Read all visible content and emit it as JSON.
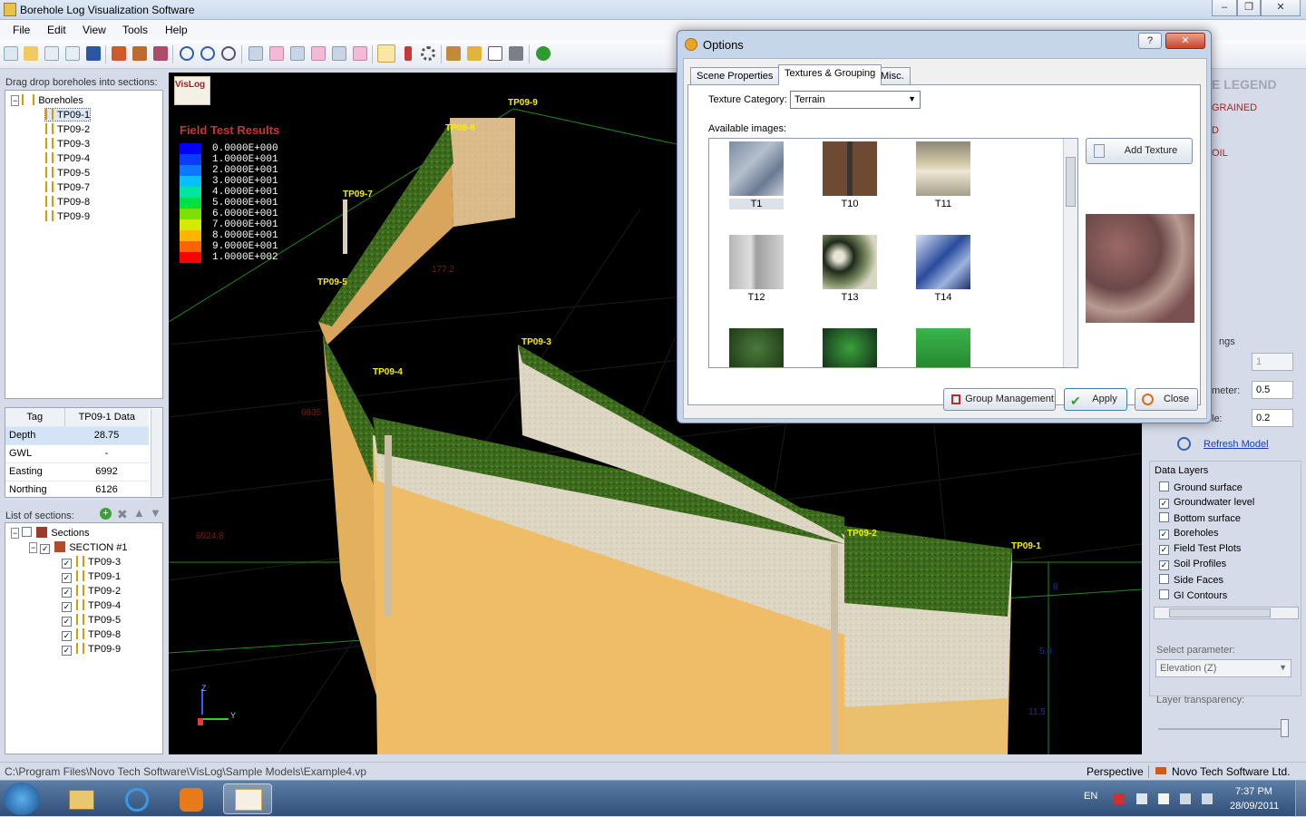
{
  "window": {
    "title": "Borehole Log Visualization Software"
  },
  "menu": [
    "File",
    "Edit",
    "View",
    "Tools",
    "Help"
  ],
  "left": {
    "hint": "Drag  drop boreholes into sections:",
    "tree_root": "Boreholes",
    "boreholes": [
      "TP09-1",
      "TP09-2",
      "TP09-3",
      "TP09-4",
      "TP09-5",
      "TP09-7",
      "TP09-8",
      "TP09-9"
    ],
    "grid_headers": [
      "Tag",
      "TP09-1 Data"
    ],
    "grid_rows": [
      {
        "tag": "Depth",
        "value": "28.75"
      },
      {
        "tag": "GWL",
        "value": "-"
      },
      {
        "tag": "Easting",
        "value": "6992"
      },
      {
        "tag": "Northing",
        "value": "6126"
      }
    ],
    "sections_label": "List of sections:",
    "sections_root": "Sections",
    "section_name": "SECTION #1",
    "section_items": [
      "TP09-3",
      "TP09-1",
      "TP09-2",
      "TP09-4",
      "TP09-5",
      "TP09-8",
      "TP09-9"
    ]
  },
  "viewport": {
    "logo_text": "VisLog",
    "legend_title": "Field Test Results",
    "legend": [
      {
        "label": "0.0000E+000",
        "color": "#0000ff"
      },
      {
        "label": "1.0000E+001",
        "color": "#0a3cff"
      },
      {
        "label": "2.0000E+001",
        "color": "#0a78ff"
      },
      {
        "label": "3.0000E+001",
        "color": "#08c0ff"
      },
      {
        "label": "4.0000E+001",
        "color": "#00e6a0"
      },
      {
        "label": "5.0000E+001",
        "color": "#00e040"
      },
      {
        "label": "6.0000E+001",
        "color": "#7ae000"
      },
      {
        "label": "7.0000E+001",
        "color": "#d8e800"
      },
      {
        "label": "8.0000E+001",
        "color": "#ffb400"
      },
      {
        "label": "9.0000E+001",
        "color": "#ff6400"
      },
      {
        "label": "1.0000E+002",
        "color": "#ff0000"
      }
    ],
    "bh_labels": [
      "TP09-9",
      "TP09-8",
      "TP09-7",
      "TP09-5",
      "TP09-4",
      "TP09-3",
      "TP09-2",
      "TP09-1"
    ],
    "axis_numbers": [
      "177.2",
      "6924.8",
      "6935",
      "8",
      "5.8",
      "11.5"
    ],
    "axis_letters": [
      "Z",
      "Y"
    ]
  },
  "dialog": {
    "title": "Options",
    "tabs": [
      "Scene Properties",
      "Textures & Grouping",
      "Misc."
    ],
    "texture_category_label": "Texture Category:",
    "texture_category_value": "Terrain",
    "available_images_label": "Available images:",
    "thumbs": [
      "T1",
      "T10",
      "T11",
      "T12",
      "T13",
      "T14"
    ],
    "add_texture": "Add Texture",
    "group_management": "Group Management",
    "apply": "Apply",
    "close": "Close"
  },
  "right": {
    "legend_partial": "E LEGEND",
    "legend_item1": "GRAINED",
    "legend_item2": "D",
    "legend_item3": "OIL",
    "settings_partial": "ngs",
    "field1_value": "1",
    "field2_label": "meter:",
    "field2_value": "0.5",
    "field3_label": "le:",
    "field3_value": "0.2",
    "refresh": "Refresh Model",
    "data_layers_title": "Data Layers",
    "layers": [
      {
        "label": "Ground surface",
        "checked": false
      },
      {
        "label": "Groundwater level",
        "checked": true
      },
      {
        "label": "Bottom surface",
        "checked": false
      },
      {
        "label": "Boreholes",
        "checked": true
      },
      {
        "label": "Field Test Plots",
        "checked": true
      },
      {
        "label": "Soil Profiles",
        "checked": true
      },
      {
        "label": "Side Faces",
        "checked": false
      },
      {
        "label": "GI Contours",
        "checked": false
      }
    ],
    "select_param_label": "Select parameter:",
    "select_param_value": "Elevation (Z)",
    "transparency_label": "Layer transparency:"
  },
  "status": {
    "path": "C:\\Program Files\\Novo Tech Software\\VisLog\\Sample Models\\Example4.vp",
    "mode": "Perspective",
    "company": "Novo Tech Software Ltd."
  },
  "taskbar": {
    "lang": "EN",
    "time": "7:37 PM",
    "date": "28/09/2011"
  },
  "colors": {
    "sand": "#e8b85a",
    "grass": "#3c6b1c",
    "clay": "#d9d3c2",
    "accent": "#2b5aa8"
  }
}
